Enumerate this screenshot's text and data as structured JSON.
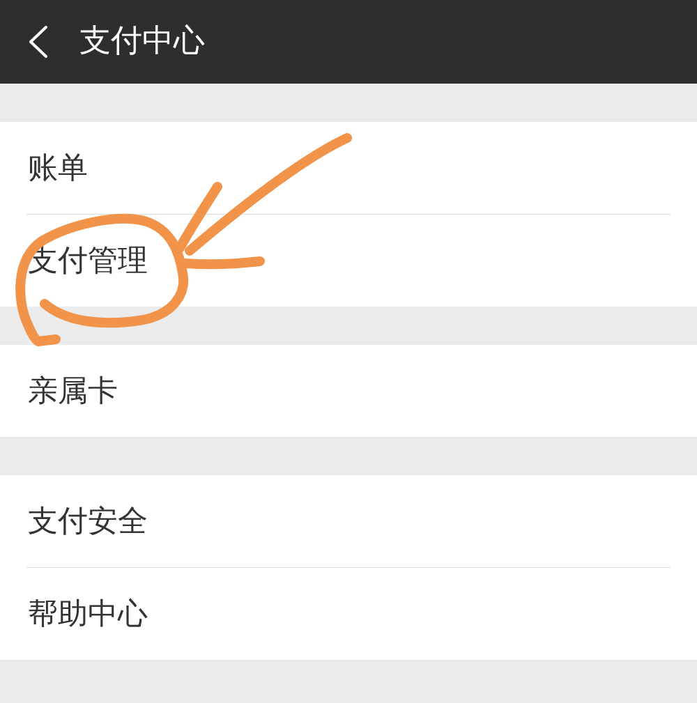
{
  "header": {
    "title": "支付中心"
  },
  "groups": [
    {
      "items": [
        {
          "label": "账单"
        },
        {
          "label": "支付管理"
        }
      ]
    },
    {
      "items": [
        {
          "label": "亲属卡"
        }
      ]
    },
    {
      "items": [
        {
          "label": "支付安全"
        },
        {
          "label": "帮助中心"
        }
      ]
    }
  ]
}
